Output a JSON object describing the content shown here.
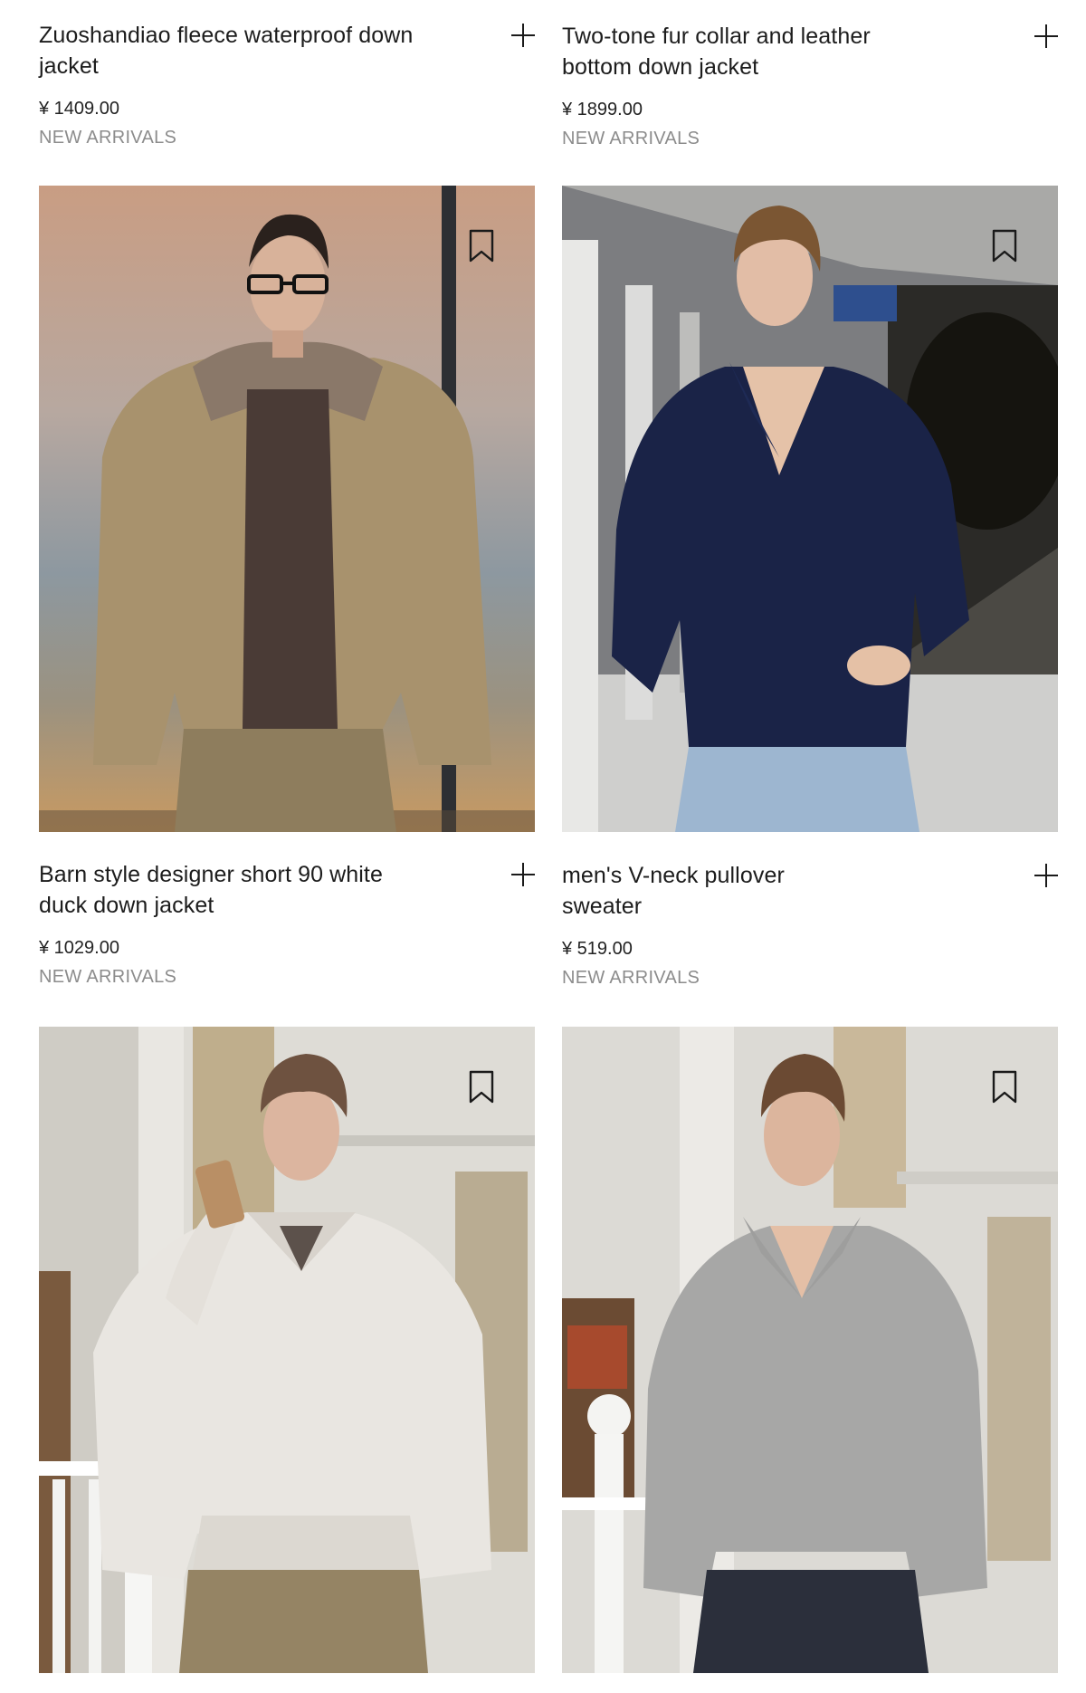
{
  "products": [
    {
      "name": "Zuoshandiao fleece waterproof down jacket",
      "price": "¥ 1409.00",
      "tag": "NEW ARRIVALS"
    },
    {
      "name": "Two-tone fur collar and leather bottom down jacket",
      "price": "¥ 1899.00",
      "tag": "NEW ARRIVALS"
    },
    {
      "name": "Barn style designer short 90 white duck down jacket",
      "price": "¥ 1029.00",
      "tag": "NEW ARRIVALS"
    },
    {
      "name": "men's V-neck pullover sweater",
      "price": "¥ 519.00",
      "tag": "NEW ARRIVALS"
    }
  ],
  "icons": {
    "add": "plus-icon",
    "save": "bookmark-icon"
  }
}
